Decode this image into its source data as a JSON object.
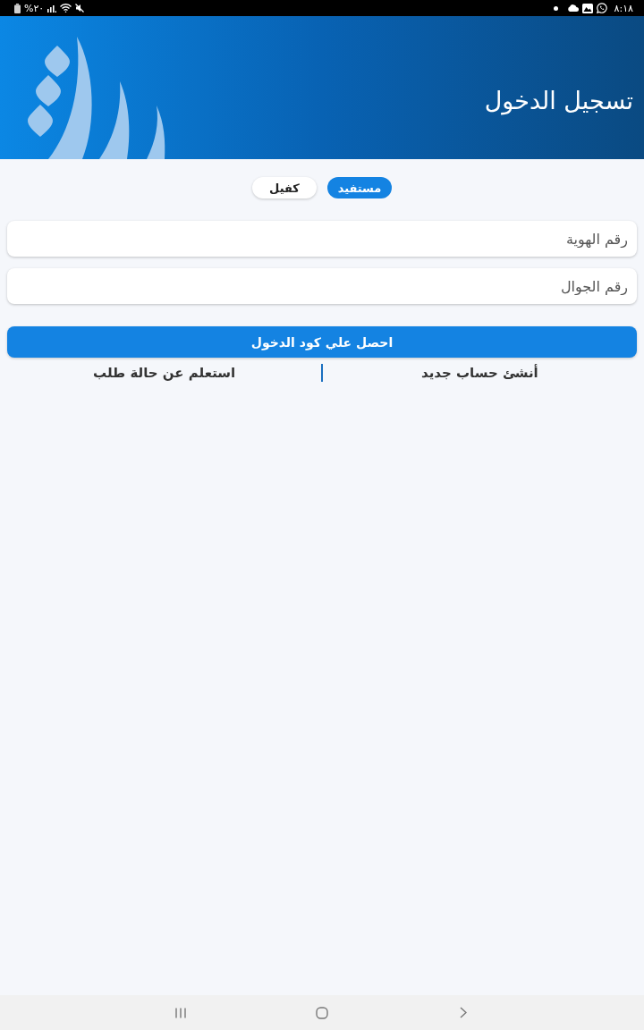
{
  "status_bar": {
    "battery": "%٢٠",
    "time": "٨:١٨"
  },
  "header": {
    "title": "تسجيل الدخول"
  },
  "tabs": [
    {
      "label": "مستفيد",
      "selected": true
    },
    {
      "label": "كفيل",
      "selected": false
    }
  ],
  "fields": [
    {
      "placeholder": "رقم الهوية"
    },
    {
      "placeholder": "رقم الجوال"
    }
  ],
  "submit_button": {
    "label": "احصل علي كود الدخول"
  },
  "links": [
    {
      "label": "أنشئ حساب جديد"
    },
    {
      "label": "استعلم عن حالة طلب"
    }
  ]
}
